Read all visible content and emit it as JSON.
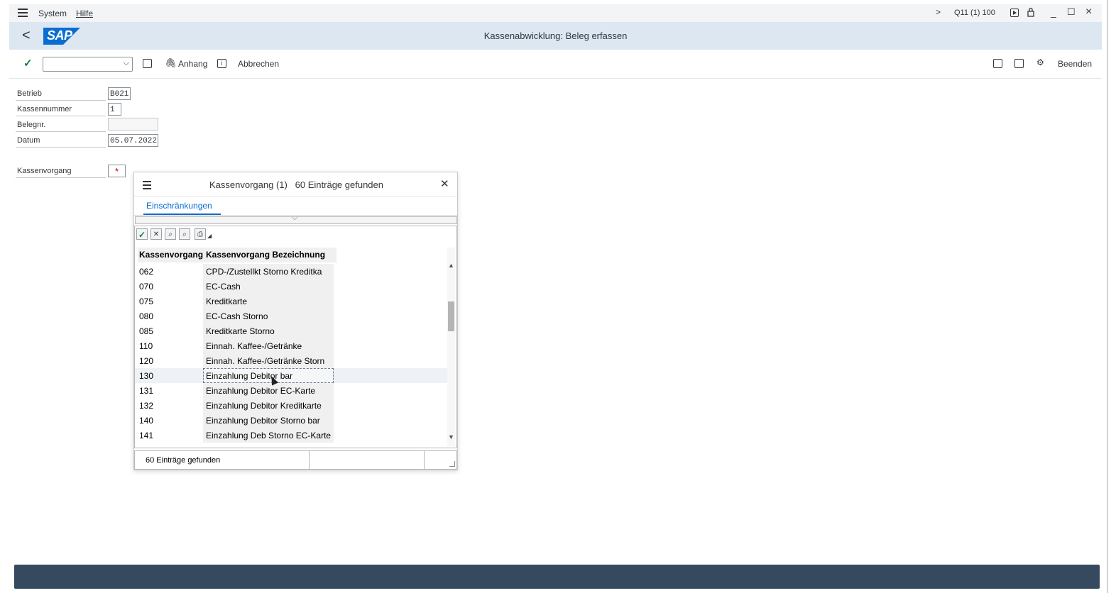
{
  "menu": {
    "system": "System",
    "hilfe": "Hilfe"
  },
  "session": {
    "arrow": ">",
    "client": "Q11 (1) 100",
    "window_controls": [
      "_",
      "☐",
      "×"
    ]
  },
  "header": {
    "back": "<",
    "logo": "SAP",
    "title": "Kassenabwicklung: Beleg erfassen"
  },
  "toolbar": {
    "command_placeholder": "",
    "anhang": "Anhang",
    "abbrechen": "Abbrechen",
    "beenden": "Beenden"
  },
  "form": {
    "betrieb": {
      "label": "Betrieb",
      "value": "B021"
    },
    "kassennummer": {
      "label": "Kassennummer",
      "value": "1"
    },
    "belegnr": {
      "label": "Belegnr.",
      "value": ""
    },
    "datum": {
      "label": "Datum",
      "value": "05.07.2022"
    },
    "kassenvorgang": {
      "label": "Kassenvorgang",
      "value": "*"
    }
  },
  "popup": {
    "title": "Kassenvorgang (1)   60 Einträge gefunden",
    "tab": "Einschränkungen",
    "columns": [
      "Kassenvorgang",
      "Kassenvorgang Bezeichnung"
    ],
    "rows": [
      {
        "code": "062",
        "name": "CPD-/Zustellkt Storno Kreditka"
      },
      {
        "code": "070",
        "name": "EC-Cash"
      },
      {
        "code": "075",
        "name": "Kreditkarte"
      },
      {
        "code": "080",
        "name": "EC-Cash Storno"
      },
      {
        "code": "085",
        "name": "Kreditkarte Storno"
      },
      {
        "code": "110",
        "name": "Einnah. Kaffee-/Getränke"
      },
      {
        "code": "120",
        "name": "Einnah. Kaffee-/Getränke Storn"
      },
      {
        "code": "130",
        "name": "Einzahlung Debitor bar"
      },
      {
        "code": "131",
        "name": "Einzahlung Debitor EC-Karte"
      },
      {
        "code": "132",
        "name": "Einzahlung Debitor Kreditkarte"
      },
      {
        "code": "140",
        "name": "Einzahlung Debitor Storno bar"
      },
      {
        "code": "141",
        "name": "Einzahlung Deb Storno EC-Karte"
      }
    ],
    "selected_row_index": 7,
    "status": "60 Einträge gefunden"
  },
  "colors": {
    "header_bg": "#dce7f2",
    "footer_bg": "#354a5f",
    "accent": "#0a6ed1",
    "ok_green": "#107e3e"
  }
}
